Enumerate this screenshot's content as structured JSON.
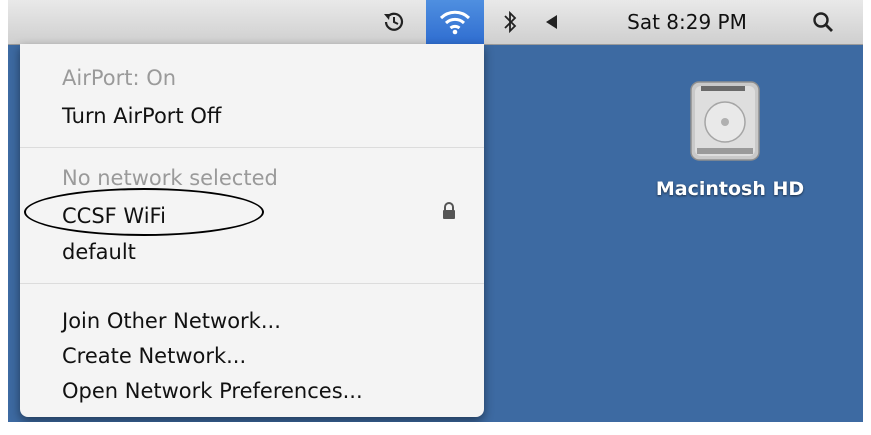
{
  "menubar": {
    "time_machine_icon": "time-machine-icon",
    "wifi_icon": "wifi-icon",
    "bluetooth_icon": "bluetooth-icon",
    "volume_icon": "volume-icon",
    "clock": "Sat 8:29 PM",
    "spotlight_icon": "spotlight-search-icon"
  },
  "airport_menu": {
    "status": "AirPort: On",
    "toggle": "Turn AirPort Off",
    "no_network": "No network selected",
    "networks": [
      {
        "name": "CCSF WiFi",
        "secured": true
      },
      {
        "name": "default",
        "secured": false
      }
    ],
    "join_other": "Join Other Network...",
    "create": "Create Network...",
    "open_prefs": "Open Network Preferences..."
  },
  "desktop": {
    "drive_label": "Macintosh HD"
  },
  "colors": {
    "desktop": "#3d6aa2",
    "menu_bg": "#f4f4f4",
    "highlight": "#3a7be0"
  }
}
